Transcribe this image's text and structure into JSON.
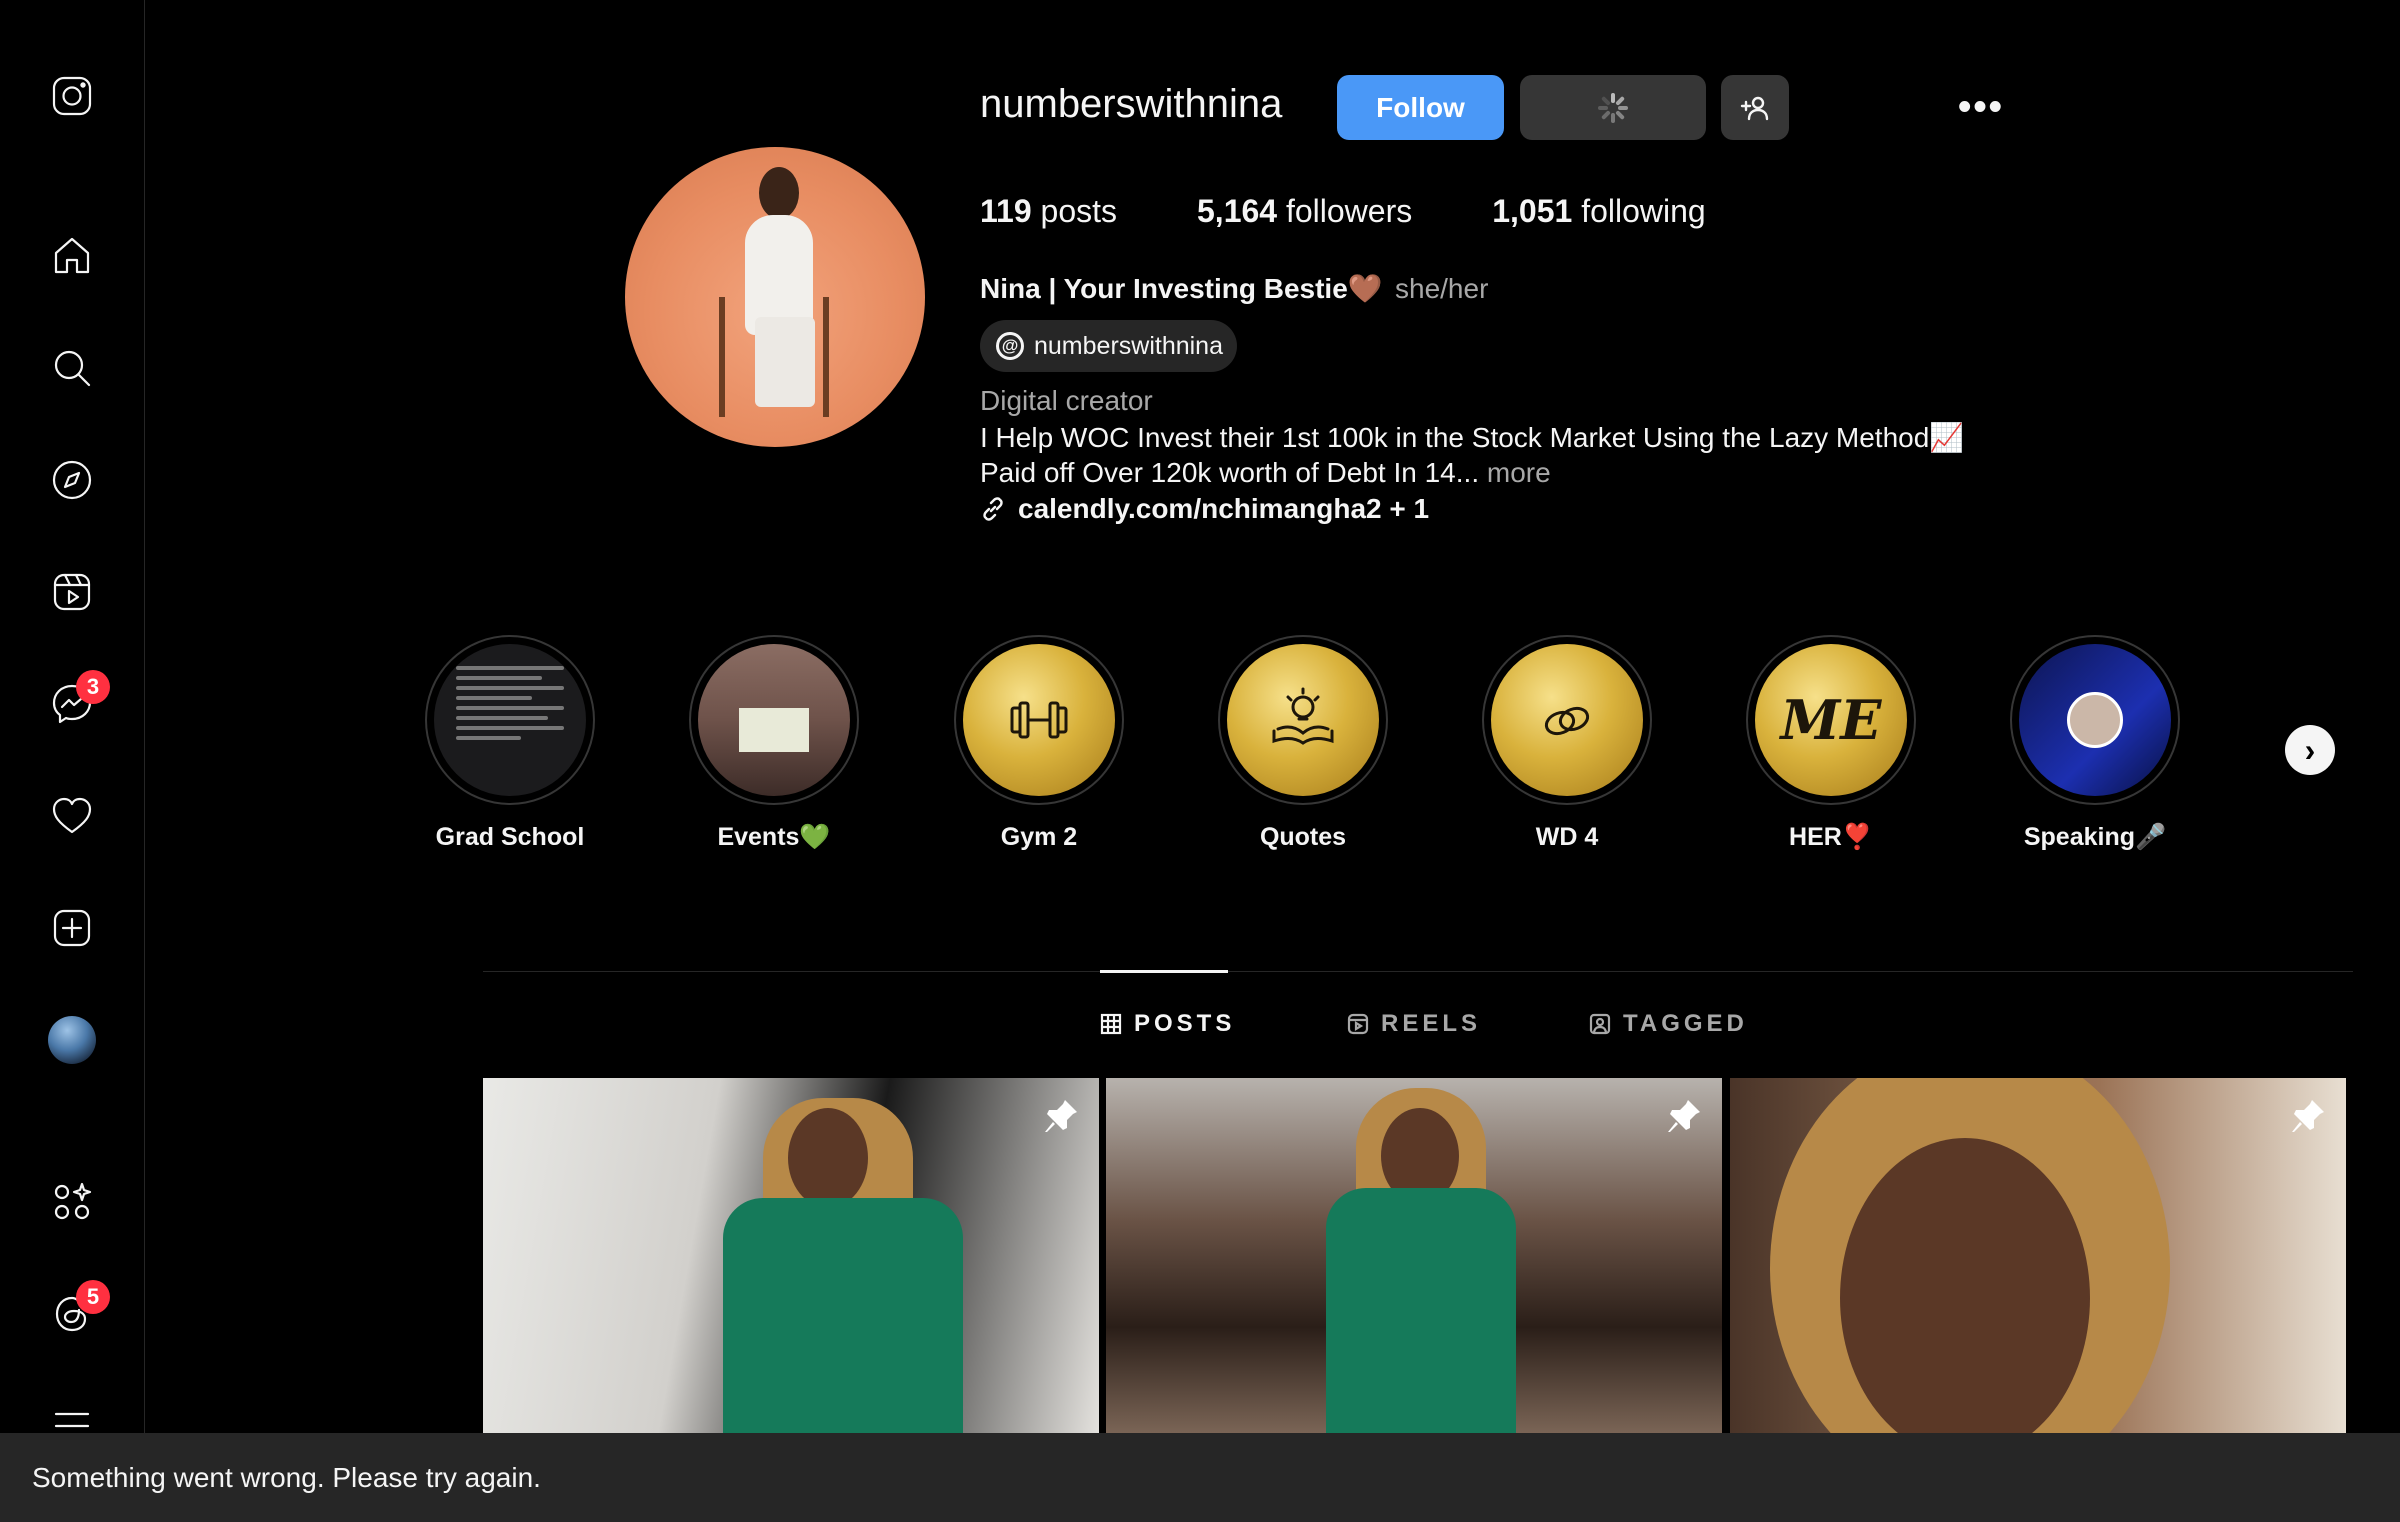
{
  "sidebar": {
    "messages_badge": "3",
    "threads_badge": "5"
  },
  "profile": {
    "username": "numberswithnina",
    "follow_label": "Follow",
    "more_label": "•••",
    "stats": {
      "posts_count": "119",
      "posts_label": "posts",
      "followers_count": "5,164",
      "followers_label": "followers",
      "following_count": "1,051",
      "following_label": "following"
    },
    "full_name": "Nina | Your Investing Bestie🤎",
    "pronouns": "she/her",
    "threads_handle": "numberswithnina",
    "category": "Digital creator",
    "bio_line1": "I Help WOC Invest their 1st 100k in the Stock Market Using the Lazy Method📈",
    "bio_line2": "Paid off Over 120k worth of Debt In 14...",
    "bio_more": "more",
    "link": "calendly.com/nchimangha2 + 1"
  },
  "highlights": [
    {
      "label": "Grad School"
    },
    {
      "label": "Events💚"
    },
    {
      "label": "Gym 2"
    },
    {
      "label": "Quotes"
    },
    {
      "label": "WD 4"
    },
    {
      "label": "HER❣️"
    },
    {
      "label": "Speaking🎤"
    }
  ],
  "highlight_symbols": {
    "her": "ME"
  },
  "tabs": {
    "posts": "POSTS",
    "reels": "REELS",
    "tagged": "TAGGED"
  },
  "toast": {
    "message": "Something went wrong. Please try again."
  },
  "colors": {
    "accent": "#4a98f7",
    "background": "#000000",
    "badge": "#ff3040"
  }
}
